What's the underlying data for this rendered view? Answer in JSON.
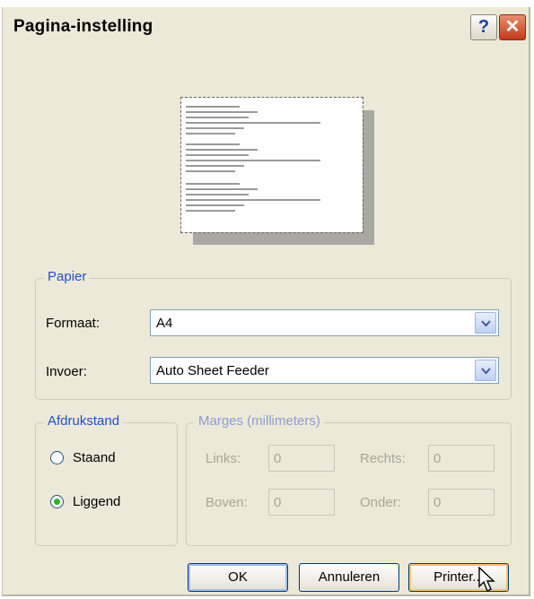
{
  "dialog": {
    "title": "Pagina-instelling"
  },
  "title_buttons": {
    "help": "?",
    "close": "✕"
  },
  "paper": {
    "legend": "Papier",
    "format_label": "Formaat:",
    "format_value": "A4",
    "source_label": "Invoer:",
    "source_value": "Auto Sheet Feeder"
  },
  "orientation": {
    "legend": "Afdrukstand",
    "portrait": "Staand",
    "landscape": "Liggend",
    "selected": "Liggend"
  },
  "margins": {
    "legend": "Marges (millimeters)",
    "left_label": "Links:",
    "left_value": "0",
    "right_label": "Rechts:",
    "right_value": "0",
    "top_label": "Boven:",
    "top_value": "0",
    "bottom_label": "Onder:",
    "bottom_value": "0"
  },
  "buttons": {
    "ok": "OK",
    "cancel": "Annuleren",
    "printer": "Printer..."
  }
}
